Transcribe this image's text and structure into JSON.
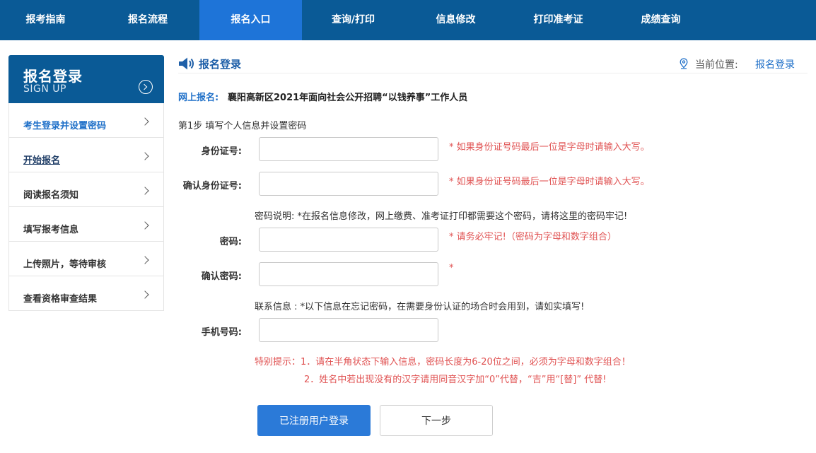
{
  "topnav": {
    "items": [
      {
        "label": "报考指南"
      },
      {
        "label": "报名流程"
      },
      {
        "label": "报名入口"
      },
      {
        "label": "查询/打印"
      },
      {
        "label": "信息修改"
      },
      {
        "label": "打印准考证"
      },
      {
        "label": "成绩查询"
      }
    ],
    "active_index": 2
  },
  "sidebar": {
    "title": "报名登录",
    "subtitle": "SIGN UP",
    "items": [
      {
        "label": "考生登录并设置密码"
      },
      {
        "label": "开始报名"
      },
      {
        "label": "阅读报名须知"
      },
      {
        "label": "填写报考信息"
      },
      {
        "label": "上传照片，等待审核"
      },
      {
        "label": "查看资格审查结果"
      }
    ]
  },
  "main": {
    "title": "报名登录",
    "location_label": "当前位置:",
    "location_link": "报名登录",
    "sub_prefix": "网上报名:",
    "sub_text": "襄阳高新区2021年面向社会公开招聘“以钱养事”工作人员",
    "step": "第1步  填写个人信息并设置密码"
  },
  "form": {
    "id_label": "身份证号:",
    "id_value": "",
    "id_hint": "* 如果身份证号码最后一位是字母时请输入大写。",
    "id_confirm_label": "确认身份证号:",
    "id_confirm_value": "",
    "id_confirm_hint": "* 如果身份证号码最后一位是字母时请输入大写。",
    "password_note": "密码说明: *在报名信息修改，网上缴费、准考证打印都需要这个密码，请将这里的密码牢记!",
    "password_label": "密码:",
    "password_value": "",
    "password_hint": "* 请务必牢记!（密码为字母和数字组合）",
    "password_confirm_label": "确认密码:",
    "password_confirm_value": "",
    "password_confirm_hint": "*",
    "contact_note": "联系信息 : *以下信息在忘记密码，在需要身份认证的场合时会用到，请如实填写!",
    "phone_label": "手机号码:",
    "phone_value": ""
  },
  "tips": {
    "line1": "特别提示：1．请在半角状态下输入信息，密码长度为6-20位之间，必须为字母和数字组合！",
    "line2": "2．姓名中若出现没有的汉字请用同音汉字加“0”代替，“吉”用“[替]” 代替!"
  },
  "buttons": {
    "login": "已注册用户登录",
    "next": "下一步"
  },
  "colors": {
    "nav_bg": "#0a5a96",
    "nav_active": "#1e74d8",
    "accent": "#1e6fc8",
    "hint_red": "#e05252",
    "primary_button": "#2b7ad8"
  }
}
